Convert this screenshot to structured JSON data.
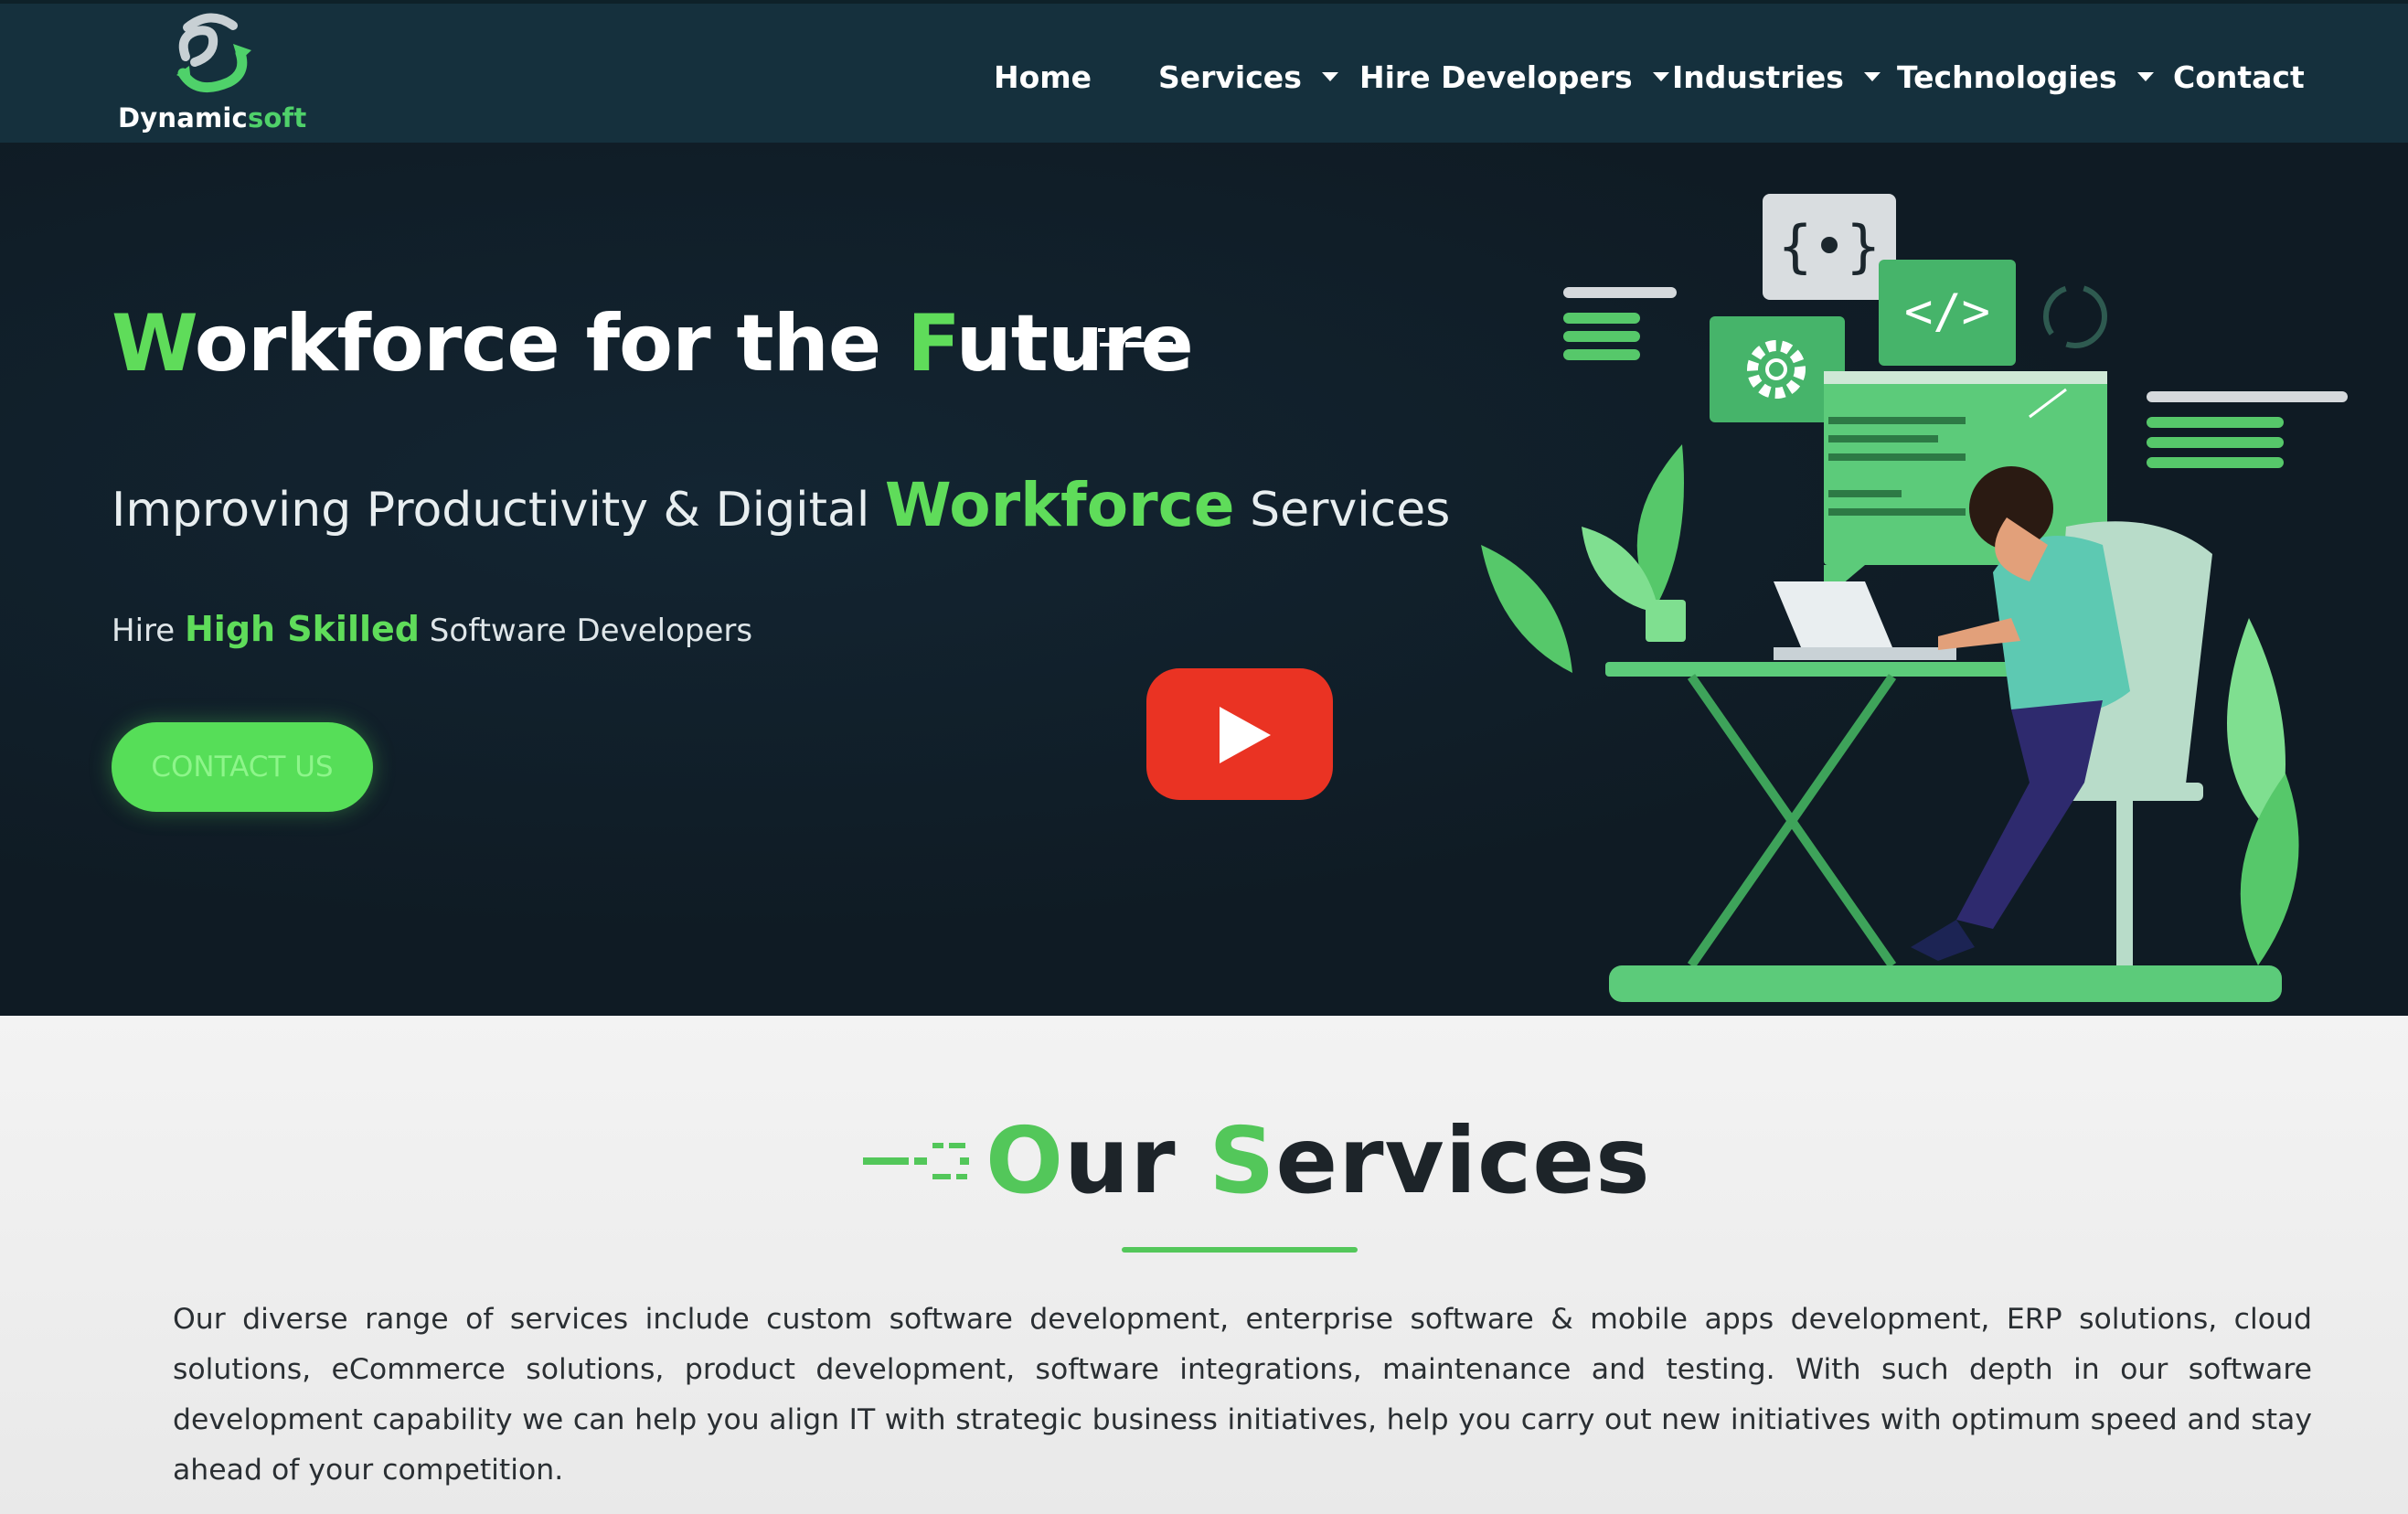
{
  "brand": {
    "name_part1": "Dynamic",
    "name_part2": "soft",
    "accent_color": "#5fdc5a",
    "nav_bg": "#15303d",
    "hero_bg": "#0f1b24"
  },
  "nav": {
    "items": [
      {
        "label": "Home",
        "has_dropdown": false
      },
      {
        "label": "Services",
        "has_dropdown": true
      },
      {
        "label": "Hire Developers",
        "has_dropdown": true
      },
      {
        "label": "Industries",
        "has_dropdown": true
      },
      {
        "label": "Technologies",
        "has_dropdown": true
      },
      {
        "label": "Contact",
        "has_dropdown": false
      }
    ]
  },
  "hero": {
    "title_w": "W",
    "title_a": "orkforce for the ",
    "title_f": "F",
    "title_b": "uture",
    "subtitle_a": "Improving Productivity & Digital ",
    "subtitle_highlight": "Workforce",
    "subtitle_b": " Services",
    "tagline_a": "Hire ",
    "tagline_highlight": "High Skilled",
    "tagline_b": " Software Developers",
    "cta_label": "CONTACT US",
    "play_icon": "youtube-play-icon"
  },
  "services": {
    "title_o": "O",
    "title_a": "ur ",
    "title_s": "S",
    "title_b": "ervices",
    "description": "Our diverse range of services include custom software development, enterprise software & mobile apps development, ERP solutions, cloud solutions, eCommerce solutions, product development, software integrations, maintenance and testing. With such depth in our software development capability we can help you align IT with strategic business initiatives, help you carry out new initiatives with optimum speed and stay ahead of your competition."
  }
}
